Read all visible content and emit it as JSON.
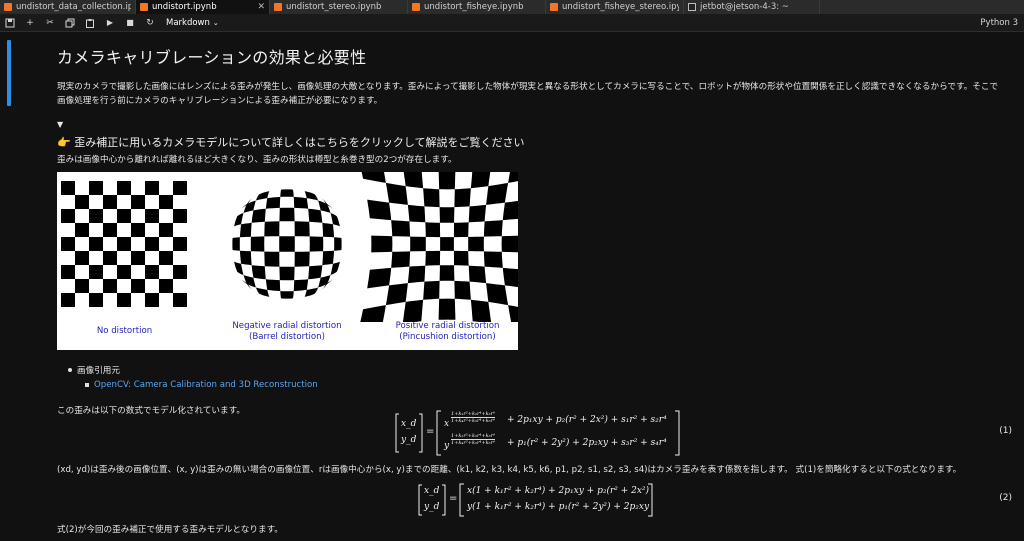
{
  "tabs": [
    {
      "label": "undistort_data_collection.ipy",
      "icon": "notebook-icon",
      "active": false
    },
    {
      "label": "undistort.ipynb",
      "icon": "notebook-icon",
      "active": true
    },
    {
      "label": "undistort_stereo.ipynb",
      "icon": "notebook-icon",
      "active": false
    },
    {
      "label": "undistort_fisheye.ipynb",
      "icon": "notebook-icon",
      "active": false
    },
    {
      "label": "undistort_fisheye_stereo.ipyn",
      "icon": "notebook-icon",
      "active": false
    },
    {
      "label": "jetbot@jetson-4-3: ~",
      "icon": "terminal-icon",
      "active": false
    }
  ],
  "toolbar": {
    "cell_type": "Markdown",
    "kernel": "Python 3"
  },
  "notebook": {
    "title": "カメラキャリブレーションの効果と必要性",
    "intro": "現実のカメラで撮影した画像にはレンズによる歪みが発生し、画像処理の大敵となります。歪みによって撮影した物体が現実と異なる形状としてカメラに写ることで、ロボットが物体の形状や位置関係を正しく認識できなくなるからです。そこで画像処理を行う前にカメラのキャリブレーションによる歪み補正が必要になります。",
    "toggle_glyph": "▼",
    "summary": "👉 歪み補正に用いるカメラモデルについて詳しくはこちらをクリックして解説をご覧ください",
    "distortion_note": "歪みは画像中心から離れれば離れるほど大きくなり、歪みの形状は樽型と糸巻き型の2つが存在します。",
    "figure": {
      "labels": [
        {
          "line1": "No distortion",
          "line2": ""
        },
        {
          "line1": "Negative radial distortion",
          "line2": "(Barrel distortion)"
        },
        {
          "line1": "Positive radial distortion",
          "line2": "(Pincushion distortion)"
        }
      ]
    },
    "refs": {
      "heading": "画像引用元",
      "link": "OpenCV: Camera Calibration and 3D Reconstruction"
    },
    "model_intro": "この歪みは以下の数式でモデル化されています。",
    "eq1": {
      "lhs_top": "x_d",
      "lhs_bottom": "y_d",
      "row1_frac_num": "1+k₁r²+k₂r⁴+k₃r⁶",
      "row1_frac_den": "1+k₄r²+k₅r⁴+k₆r⁶",
      "row1_rest": "+ 2p₁xy + p₂(r² + 2x²) + s₁r² + s₂r⁴",
      "row1_var": "x",
      "row2_var": "y",
      "row2_rest": "+ p₁(r² + 2y²) + 2p₂xy + s₃r² + s₄r⁴",
      "number": "(1)"
    },
    "explanation": {
      "part1": "(x",
      "text": "(xd, yd)は歪み後の画像位置、(x, y)は歪みの無い場合の画像位置、rは画像中心から(x, y)までの距離、(k1, k2, k3, k4, k5, k6, p1, p2, s1, s2, s3, s4)はカメラ歪みを表す係数を指します。 式(1)を簡略化すると以下の式となります。"
    },
    "eq2": {
      "lhs_top": "x_d",
      "lhs_bottom": "y_d",
      "row1": "x(1 + k₁r² + k₂r⁴) + 2p₁xy + p₂(r² + 2x²)",
      "row2": "y(1 + k₁r² + k₂r⁴) + p₁(r² + 2y²) + 2p₂xy",
      "number": "(2)"
    },
    "conclusion": "式(2)が今回の歪み補正で使用する歪みモデルとなります。"
  }
}
